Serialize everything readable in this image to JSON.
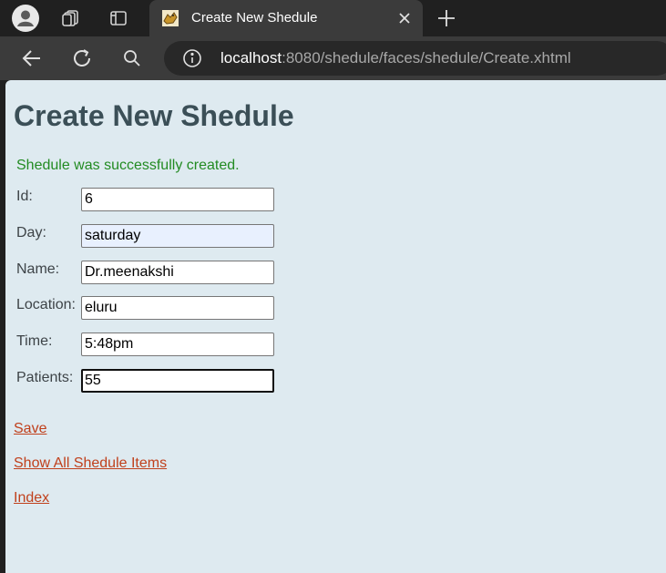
{
  "browser": {
    "tab_title": "Create New Shedule",
    "url_host": "localhost",
    "url_rest": ":8080/shedule/faces/shedule/Create.xhtml"
  },
  "page": {
    "title": "Create New Shedule",
    "message": "Shedule was successfully created.",
    "fields": [
      {
        "label": "Id:",
        "value": "6"
      },
      {
        "label": "Day:",
        "value": "saturday"
      },
      {
        "label": "Name:",
        "value": "Dr.meenakshi"
      },
      {
        "label": "Location:",
        "value": "eluru"
      },
      {
        "label": "Time:",
        "value": "5:48pm"
      },
      {
        "label": "Patients:",
        "value": "55"
      }
    ],
    "links": {
      "save": "Save",
      "show_all": "Show All Shedule Items",
      "index": "Index"
    }
  },
  "colors": {
    "page_bg": "#deeaf0",
    "title": "#3b4f57",
    "success": "#228b22",
    "link": "#c0401c"
  }
}
